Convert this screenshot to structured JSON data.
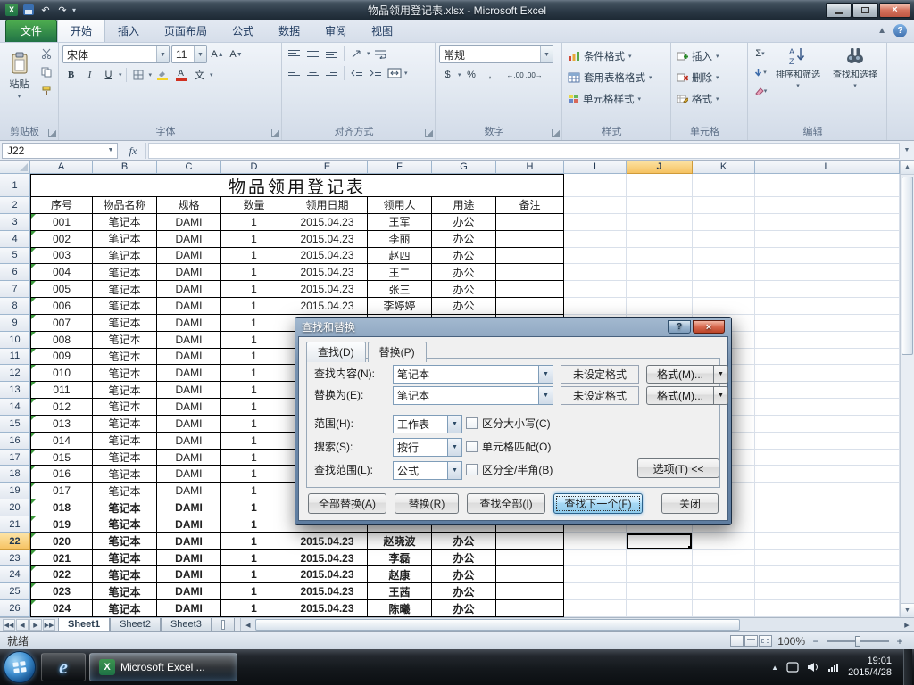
{
  "window": {
    "title": "物品领用登记表.xlsx - Microsoft Excel"
  },
  "ribbon": {
    "file_tab": "文件",
    "tabs": [
      "开始",
      "插入",
      "页面布局",
      "公式",
      "数据",
      "审阅",
      "视图"
    ],
    "active_tab": "开始",
    "clipboard": {
      "label": "剪贴板",
      "paste": "粘贴"
    },
    "font": {
      "label": "字体",
      "font_name": "宋体",
      "font_size": "11",
      "bold": "B",
      "italic": "I",
      "underline": "U",
      "phonetic": "文"
    },
    "alignment": {
      "label": "对齐方式"
    },
    "number": {
      "label": "数字",
      "format": "常规",
      "accounting": "$",
      "percent": "%",
      "comma": ",",
      "decimals": "00"
    },
    "styles": {
      "label": "样式",
      "items": [
        "条件格式",
        "套用表格格式",
        "单元格样式"
      ]
    },
    "cells": {
      "label": "单元格",
      "items": [
        "插入",
        "删除",
        "格式"
      ]
    },
    "editing": {
      "label": "编辑",
      "sigma": "Σ",
      "items": [
        "排序和筛选",
        "查找和选择"
      ]
    }
  },
  "formula_bar": {
    "name_box": "J22",
    "fx": "fx",
    "value": ""
  },
  "grid": {
    "columns": [
      "A",
      "B",
      "C",
      "D",
      "E",
      "F",
      "G",
      "H",
      "I",
      "J",
      "K",
      "L"
    ],
    "selected_column": "J",
    "selected_row": 22,
    "title_row": "物品领用登记表",
    "header_row": [
      "序号",
      "物品名称",
      "规格",
      "数量",
      "领用日期",
      "领用人",
      "用途",
      "备注"
    ],
    "rows": [
      {
        "no": "001",
        "item": "笔记本",
        "spec": "DAMI",
        "qty": "1",
        "date": "2015.04.23",
        "person": "王军",
        "use": "办公",
        "note": "",
        "bold": false
      },
      {
        "no": "002",
        "item": "笔记本",
        "spec": "DAMI",
        "qty": "1",
        "date": "2015.04.23",
        "person": "李丽",
        "use": "办公",
        "note": "",
        "bold": false
      },
      {
        "no": "003",
        "item": "笔记本",
        "spec": "DAMI",
        "qty": "1",
        "date": "2015.04.23",
        "person": "赵四",
        "use": "办公",
        "note": "",
        "bold": false
      },
      {
        "no": "004",
        "item": "笔记本",
        "spec": "DAMI",
        "qty": "1",
        "date": "2015.04.23",
        "person": "王二",
        "use": "办公",
        "note": "",
        "bold": false
      },
      {
        "no": "005",
        "item": "笔记本",
        "spec": "DAMI",
        "qty": "1",
        "date": "2015.04.23",
        "person": "张三",
        "use": "办公",
        "note": "",
        "bold": false
      },
      {
        "no": "006",
        "item": "笔记本",
        "spec": "DAMI",
        "qty": "1",
        "date": "2015.04.23",
        "person": "李婷婷",
        "use": "办公",
        "note": "",
        "bold": false
      },
      {
        "no": "007",
        "item": "笔记本",
        "spec": "DAMI",
        "qty": "1",
        "date": "",
        "person": "",
        "use": "",
        "note": "",
        "bold": false
      },
      {
        "no": "008",
        "item": "笔记本",
        "spec": "DAMI",
        "qty": "1",
        "date": "",
        "person": "",
        "use": "",
        "note": "",
        "bold": false
      },
      {
        "no": "009",
        "item": "笔记本",
        "spec": "DAMI",
        "qty": "1",
        "date": "",
        "person": "",
        "use": "",
        "note": "",
        "bold": false
      },
      {
        "no": "010",
        "item": "笔记本",
        "spec": "DAMI",
        "qty": "1",
        "date": "",
        "person": "",
        "use": "",
        "note": "",
        "bold": false
      },
      {
        "no": "011",
        "item": "笔记本",
        "spec": "DAMI",
        "qty": "1",
        "date": "",
        "person": "",
        "use": "",
        "note": "",
        "bold": false
      },
      {
        "no": "012",
        "item": "笔记本",
        "spec": "DAMI",
        "qty": "1",
        "date": "",
        "person": "",
        "use": "",
        "note": "",
        "bold": false
      },
      {
        "no": "013",
        "item": "笔记本",
        "spec": "DAMI",
        "qty": "1",
        "date": "",
        "person": "",
        "use": "",
        "note": "",
        "bold": false
      },
      {
        "no": "014",
        "item": "笔记本",
        "spec": "DAMI",
        "qty": "1",
        "date": "",
        "person": "",
        "use": "",
        "note": "",
        "bold": false
      },
      {
        "no": "015",
        "item": "笔记本",
        "spec": "DAMI",
        "qty": "1",
        "date": "",
        "person": "",
        "use": "",
        "note": "",
        "bold": false
      },
      {
        "no": "016",
        "item": "笔记本",
        "spec": "DAMI",
        "qty": "1",
        "date": "",
        "person": "",
        "use": "",
        "note": "",
        "bold": false
      },
      {
        "no": "017",
        "item": "笔记本",
        "spec": "DAMI",
        "qty": "1",
        "date": "",
        "person": "",
        "use": "",
        "note": "",
        "bold": false
      },
      {
        "no": "018",
        "item": "笔记本",
        "spec": "DAMI",
        "qty": "1",
        "date": "",
        "person": "",
        "use": "",
        "note": "",
        "bold": true
      },
      {
        "no": "019",
        "item": "笔记本",
        "spec": "DAMI",
        "qty": "1",
        "date": "",
        "person": "",
        "use": "",
        "note": "",
        "bold": true
      },
      {
        "no": "020",
        "item": "笔记本",
        "spec": "DAMI",
        "qty": "1",
        "date": "2015.04.23",
        "person": "赵晓波",
        "use": "办公",
        "note": "",
        "bold": true
      },
      {
        "no": "021",
        "item": "笔记本",
        "spec": "DAMI",
        "qty": "1",
        "date": "2015.04.23",
        "person": "李磊",
        "use": "办公",
        "note": "",
        "bold": true
      },
      {
        "no": "022",
        "item": "笔记本",
        "spec": "DAMI",
        "qty": "1",
        "date": "2015.04.23",
        "person": "赵康",
        "use": "办公",
        "note": "",
        "bold": true
      },
      {
        "no": "023",
        "item": "笔记本",
        "spec": "DAMI",
        "qty": "1",
        "date": "2015.04.23",
        "person": "王茜",
        "use": "办公",
        "note": "",
        "bold": true
      },
      {
        "no": "024",
        "item": "笔记本",
        "spec": "DAMI",
        "qty": "1",
        "date": "2015.04.23",
        "person": "陈曦",
        "use": "办公",
        "note": "",
        "bold": true
      }
    ]
  },
  "dialog": {
    "title": "查找和替换",
    "tabs": [
      "查找(D)",
      "替换(P)"
    ],
    "active_tab": "替换(P)",
    "find_label": "查找内容(N):",
    "find_value": "笔记本",
    "replace_label": "替换为(E):",
    "replace_value": "笔记本",
    "format_preview": "未设定格式",
    "format_button": "格式(M)...",
    "scope_label": "范围(H):",
    "scope_value": "工作表",
    "search_label": "搜索(S):",
    "search_value": "按行",
    "look_in_label": "查找范围(L):",
    "look_in_value": "公式",
    "checkboxes": [
      "区分大小写(C)",
      "单元格匹配(O)",
      "区分全/半角(B)"
    ],
    "options_button": "选项(T) <<",
    "buttons": [
      "全部替换(A)",
      "替换(R)",
      "查找全部(I)",
      "查找下一个(F)",
      "关闭"
    ],
    "default_button": "查找下一个(F)"
  },
  "sheet_tabs": {
    "tabs": [
      "Sheet1",
      "Sheet2",
      "Sheet3"
    ],
    "active": "Sheet1"
  },
  "status_bar": {
    "ready": "就绪",
    "zoom": "100%"
  },
  "taskbar": {
    "excel_button": "Microsoft Excel ...",
    "time": "19:01",
    "date": "2015/4/28"
  }
}
